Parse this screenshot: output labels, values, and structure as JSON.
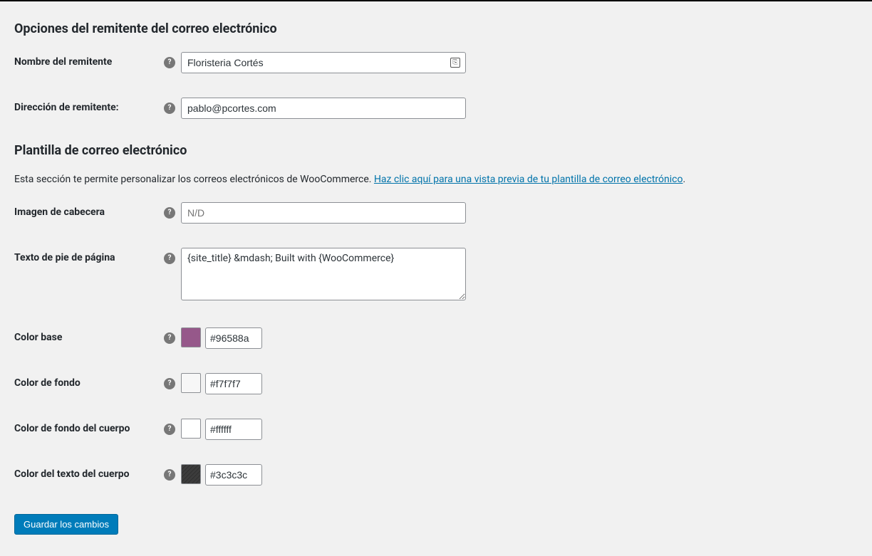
{
  "section1": {
    "title": "Opciones del remitente del correo electrónico"
  },
  "section2": {
    "title": "Plantilla de correo electrónico",
    "desc_prefix": "Esta sección te permite personalizar los correos electrónicos de WooCommerce. ",
    "desc_link": "Haz clic aquí para una vista previa de tu plantilla de correo electrónico",
    "desc_suffix": "."
  },
  "fields": {
    "sender_name": {
      "label": "Nombre del remitente",
      "value": "Floristeria Cortés"
    },
    "sender_email": {
      "label": "Dirección de remitente:",
      "value": "pablo@pcortes.com"
    },
    "header_image": {
      "label": "Imagen de cabecera",
      "placeholder": "N/D",
      "value": ""
    },
    "footer_text": {
      "label": "Texto de pie de página",
      "value": "{site_title} &mdash; Built with {WooCommerce}"
    },
    "base_color": {
      "label": "Color base",
      "value": "#96588a"
    },
    "bg_color": {
      "label": "Color de fondo",
      "value": "#f7f7f7"
    },
    "body_bg_color": {
      "label": "Color de fondo del cuerpo",
      "value": "#ffffff"
    },
    "body_text_color": {
      "label": "Color del texto del cuerpo",
      "value": "#3c3c3c"
    }
  },
  "actions": {
    "save": "Guardar los cambios"
  }
}
